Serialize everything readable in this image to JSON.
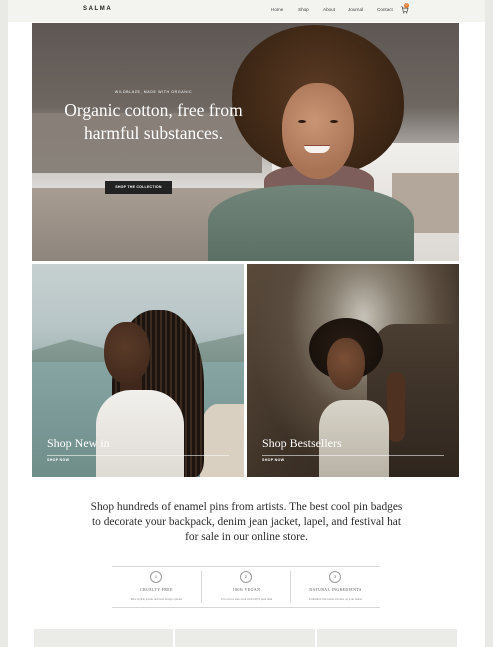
{
  "header": {
    "logo": "SALMA",
    "nav": [
      "Home",
      "Shop",
      "About",
      "Journal",
      "Contact"
    ],
    "cart_count": "0",
    "cart_icon": "cart-icon"
  },
  "hero": {
    "kicker": "WILDBLAZE, MADE WITH ORGANIC",
    "headline": "Organic cotton, free from harmful substances.",
    "cta": "SHOP THE COLLECTION"
  },
  "tiles": [
    {
      "title": "Shop New in",
      "link": "SHOP NOW"
    },
    {
      "title": "Shop Bestsellers",
      "link": "SHOP NOW"
    }
  ],
  "intro": "Shop hundreds of enamel pins from artists. The best cool pin badges to decorate your backpack, denim jean jacket, lapel, and festival hat for sale in our online store.",
  "features": [
    {
      "num": "1",
      "title": "CRUELTY FREE",
      "desc": "Pure stylish jewels and best design options"
    },
    {
      "num": "2",
      "title": "100% VEGAN",
      "desc": "You can be sure even with 100% pure item"
    },
    {
      "num": "3",
      "title": "NATURAL INGREDIENTS",
      "desc": "Unlimited free items at home on your hands"
    }
  ],
  "colors": {
    "accent": "#e0782b",
    "header_bg": "#f3f3f0",
    "cta_bg": "#222222"
  }
}
